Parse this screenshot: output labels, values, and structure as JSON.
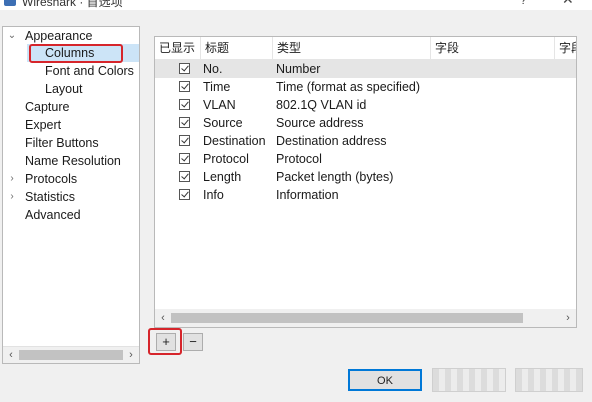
{
  "window": {
    "title": "Wireshark · 首选项",
    "help_glyph": "?",
    "close_glyph": "✕"
  },
  "tree": {
    "items": [
      {
        "label": "Appearance",
        "expanded": true
      },
      {
        "label": "Columns",
        "selected": true
      },
      {
        "label": "Font and Colors"
      },
      {
        "label": "Layout"
      },
      {
        "label": "Capture"
      },
      {
        "label": "Expert"
      },
      {
        "label": "Filter Buttons"
      },
      {
        "label": "Name Resolution"
      },
      {
        "label": "Protocols",
        "expandable": true
      },
      {
        "label": "Statistics",
        "expandable": true
      },
      {
        "label": "Advanced"
      }
    ],
    "expanded_arrow": "⌄",
    "collapsed_arrow": "›",
    "scroll_left": "‹",
    "scroll_right": "›"
  },
  "columns_table": {
    "headers": {
      "displayed": "已显示",
      "title": "标题",
      "type": "类型",
      "field": "字段",
      "field_occurrence": "字段"
    },
    "rows": [
      {
        "title": "No.",
        "type": "Number",
        "checked": true
      },
      {
        "title": "Time",
        "type": "Time (format as specified)",
        "checked": true
      },
      {
        "title": "VLAN",
        "type": "802.1Q VLAN id",
        "checked": true
      },
      {
        "title": "Source",
        "type": "Source address",
        "checked": true
      },
      {
        "title": "Destination",
        "type": "Destination address",
        "checked": true
      },
      {
        "title": "Protocol",
        "type": "Protocol",
        "checked": true
      },
      {
        "title": "Length",
        "type": "Packet length (bytes)",
        "checked": true
      },
      {
        "title": "Info",
        "type": "Information",
        "checked": true
      }
    ],
    "scroll_left": "‹",
    "scroll_right": "›"
  },
  "buttons": {
    "add": "+",
    "remove": "−",
    "ok": "OK"
  },
  "colors": {
    "selection": "#cce4f7",
    "highlight_box": "#d6252b",
    "focus_border": "#0078d7"
  }
}
